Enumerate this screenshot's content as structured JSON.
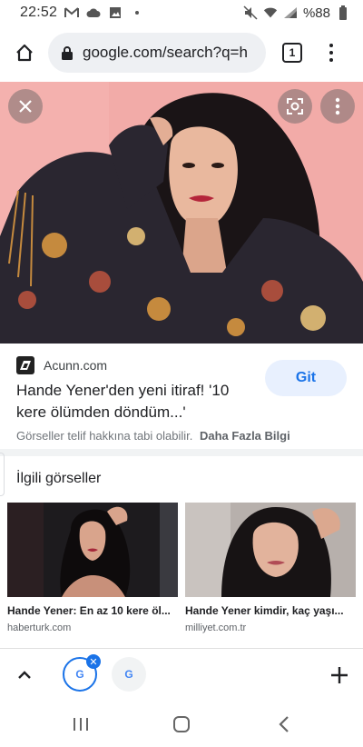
{
  "status_bar": {
    "time": "22:52",
    "battery": "%88",
    "icons": [
      "gmail-icon",
      "cloud-icon",
      "gallery-icon",
      "dot-icon",
      "mute-icon",
      "wifi-icon",
      "signal-icon",
      "battery-icon"
    ]
  },
  "browser": {
    "url": "google.com/search?q=h",
    "tab_count": "1"
  },
  "result": {
    "source_name": "Acunn.com",
    "title": "Hande Yener'den yeni itiraf! '10 kere ölümden döndüm...'",
    "visit_button": "Git",
    "copyright_notice": "Görseller telif hakkına tabi olabilir.",
    "more_info_link": "Daha Fazla Bilgi"
  },
  "related": {
    "heading": "İlgili görseller",
    "items": [
      {
        "caption": "Hande Yener: En az 10 kere öl...",
        "domain": "haberturk.com"
      },
      {
        "caption": "Hande Yener kimdir, kaç yaşı...",
        "domain": "milliyet.com.tr"
      }
    ]
  },
  "toolbar": {
    "tab_thumb_letter": "G",
    "tab_close_glyph": "✕"
  },
  "colors": {
    "accent": "#1a73e8",
    "hero_background": "#f2a9a7",
    "chip_background": "#e8f0fe"
  }
}
